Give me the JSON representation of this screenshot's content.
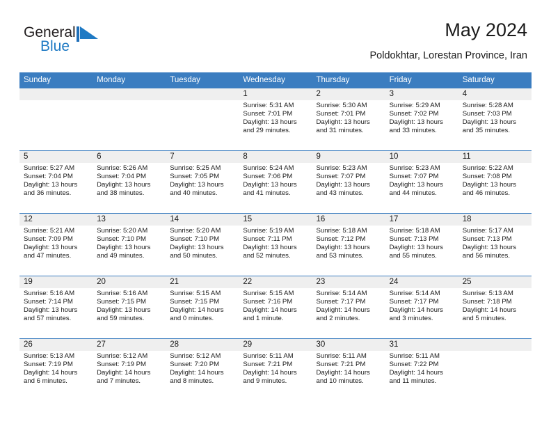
{
  "brand": {
    "name_part1": "General",
    "name_part2": "Blue",
    "flag_color": "#1f7ac4"
  },
  "header": {
    "title": "May 2024",
    "location": "Poldokhtar, Lorestan Province, Iran"
  },
  "theme": {
    "header_blue": "#3b7dc0",
    "daynum_band": "#efefef",
    "rule_blue": "#3b7dc0",
    "text": "#1a1a1a"
  },
  "weekdays": [
    "Sunday",
    "Monday",
    "Tuesday",
    "Wednesday",
    "Thursday",
    "Friday",
    "Saturday"
  ],
  "weeks": [
    [
      {
        "day": "",
        "sunrise": "",
        "sunset": "",
        "daylight_line1": "",
        "daylight_line2": ""
      },
      {
        "day": "",
        "sunrise": "",
        "sunset": "",
        "daylight_line1": "",
        "daylight_line2": ""
      },
      {
        "day": "",
        "sunrise": "",
        "sunset": "",
        "daylight_line1": "",
        "daylight_line2": ""
      },
      {
        "day": "1",
        "sunrise": "Sunrise: 5:31 AM",
        "sunset": "Sunset: 7:01 PM",
        "daylight_line1": "Daylight: 13 hours",
        "daylight_line2": "and 29 minutes."
      },
      {
        "day": "2",
        "sunrise": "Sunrise: 5:30 AM",
        "sunset": "Sunset: 7:01 PM",
        "daylight_line1": "Daylight: 13 hours",
        "daylight_line2": "and 31 minutes."
      },
      {
        "day": "3",
        "sunrise": "Sunrise: 5:29 AM",
        "sunset": "Sunset: 7:02 PM",
        "daylight_line1": "Daylight: 13 hours",
        "daylight_line2": "and 33 minutes."
      },
      {
        "day": "4",
        "sunrise": "Sunrise: 5:28 AM",
        "sunset": "Sunset: 7:03 PM",
        "daylight_line1": "Daylight: 13 hours",
        "daylight_line2": "and 35 minutes."
      }
    ],
    [
      {
        "day": "5",
        "sunrise": "Sunrise: 5:27 AM",
        "sunset": "Sunset: 7:04 PM",
        "daylight_line1": "Daylight: 13 hours",
        "daylight_line2": "and 36 minutes."
      },
      {
        "day": "6",
        "sunrise": "Sunrise: 5:26 AM",
        "sunset": "Sunset: 7:04 PM",
        "daylight_line1": "Daylight: 13 hours",
        "daylight_line2": "and 38 minutes."
      },
      {
        "day": "7",
        "sunrise": "Sunrise: 5:25 AM",
        "sunset": "Sunset: 7:05 PM",
        "daylight_line1": "Daylight: 13 hours",
        "daylight_line2": "and 40 minutes."
      },
      {
        "day": "8",
        "sunrise": "Sunrise: 5:24 AM",
        "sunset": "Sunset: 7:06 PM",
        "daylight_line1": "Daylight: 13 hours",
        "daylight_line2": "and 41 minutes."
      },
      {
        "day": "9",
        "sunrise": "Sunrise: 5:23 AM",
        "sunset": "Sunset: 7:07 PM",
        "daylight_line1": "Daylight: 13 hours",
        "daylight_line2": "and 43 minutes."
      },
      {
        "day": "10",
        "sunrise": "Sunrise: 5:23 AM",
        "sunset": "Sunset: 7:07 PM",
        "daylight_line1": "Daylight: 13 hours",
        "daylight_line2": "and 44 minutes."
      },
      {
        "day": "11",
        "sunrise": "Sunrise: 5:22 AM",
        "sunset": "Sunset: 7:08 PM",
        "daylight_line1": "Daylight: 13 hours",
        "daylight_line2": "and 46 minutes."
      }
    ],
    [
      {
        "day": "12",
        "sunrise": "Sunrise: 5:21 AM",
        "sunset": "Sunset: 7:09 PM",
        "daylight_line1": "Daylight: 13 hours",
        "daylight_line2": "and 47 minutes."
      },
      {
        "day": "13",
        "sunrise": "Sunrise: 5:20 AM",
        "sunset": "Sunset: 7:10 PM",
        "daylight_line1": "Daylight: 13 hours",
        "daylight_line2": "and 49 minutes."
      },
      {
        "day": "14",
        "sunrise": "Sunrise: 5:20 AM",
        "sunset": "Sunset: 7:10 PM",
        "daylight_line1": "Daylight: 13 hours",
        "daylight_line2": "and 50 minutes."
      },
      {
        "day": "15",
        "sunrise": "Sunrise: 5:19 AM",
        "sunset": "Sunset: 7:11 PM",
        "daylight_line1": "Daylight: 13 hours",
        "daylight_line2": "and 52 minutes."
      },
      {
        "day": "16",
        "sunrise": "Sunrise: 5:18 AM",
        "sunset": "Sunset: 7:12 PM",
        "daylight_line1": "Daylight: 13 hours",
        "daylight_line2": "and 53 minutes."
      },
      {
        "day": "17",
        "sunrise": "Sunrise: 5:18 AM",
        "sunset": "Sunset: 7:13 PM",
        "daylight_line1": "Daylight: 13 hours",
        "daylight_line2": "and 55 minutes."
      },
      {
        "day": "18",
        "sunrise": "Sunrise: 5:17 AM",
        "sunset": "Sunset: 7:13 PM",
        "daylight_line1": "Daylight: 13 hours",
        "daylight_line2": "and 56 minutes."
      }
    ],
    [
      {
        "day": "19",
        "sunrise": "Sunrise: 5:16 AM",
        "sunset": "Sunset: 7:14 PM",
        "daylight_line1": "Daylight: 13 hours",
        "daylight_line2": "and 57 minutes."
      },
      {
        "day": "20",
        "sunrise": "Sunrise: 5:16 AM",
        "sunset": "Sunset: 7:15 PM",
        "daylight_line1": "Daylight: 13 hours",
        "daylight_line2": "and 59 minutes."
      },
      {
        "day": "21",
        "sunrise": "Sunrise: 5:15 AM",
        "sunset": "Sunset: 7:15 PM",
        "daylight_line1": "Daylight: 14 hours",
        "daylight_line2": "and 0 minutes."
      },
      {
        "day": "22",
        "sunrise": "Sunrise: 5:15 AM",
        "sunset": "Sunset: 7:16 PM",
        "daylight_line1": "Daylight: 14 hours",
        "daylight_line2": "and 1 minute."
      },
      {
        "day": "23",
        "sunrise": "Sunrise: 5:14 AM",
        "sunset": "Sunset: 7:17 PM",
        "daylight_line1": "Daylight: 14 hours",
        "daylight_line2": "and 2 minutes."
      },
      {
        "day": "24",
        "sunrise": "Sunrise: 5:14 AM",
        "sunset": "Sunset: 7:17 PM",
        "daylight_line1": "Daylight: 14 hours",
        "daylight_line2": "and 3 minutes."
      },
      {
        "day": "25",
        "sunrise": "Sunrise: 5:13 AM",
        "sunset": "Sunset: 7:18 PM",
        "daylight_line1": "Daylight: 14 hours",
        "daylight_line2": "and 5 minutes."
      }
    ],
    [
      {
        "day": "26",
        "sunrise": "Sunrise: 5:13 AM",
        "sunset": "Sunset: 7:19 PM",
        "daylight_line1": "Daylight: 14 hours",
        "daylight_line2": "and 6 minutes."
      },
      {
        "day": "27",
        "sunrise": "Sunrise: 5:12 AM",
        "sunset": "Sunset: 7:19 PM",
        "daylight_line1": "Daylight: 14 hours",
        "daylight_line2": "and 7 minutes."
      },
      {
        "day": "28",
        "sunrise": "Sunrise: 5:12 AM",
        "sunset": "Sunset: 7:20 PM",
        "daylight_line1": "Daylight: 14 hours",
        "daylight_line2": "and 8 minutes."
      },
      {
        "day": "29",
        "sunrise": "Sunrise: 5:11 AM",
        "sunset": "Sunset: 7:21 PM",
        "daylight_line1": "Daylight: 14 hours",
        "daylight_line2": "and 9 minutes."
      },
      {
        "day": "30",
        "sunrise": "Sunrise: 5:11 AM",
        "sunset": "Sunset: 7:21 PM",
        "daylight_line1": "Daylight: 14 hours",
        "daylight_line2": "and 10 minutes."
      },
      {
        "day": "31",
        "sunrise": "Sunrise: 5:11 AM",
        "sunset": "Sunset: 7:22 PM",
        "daylight_line1": "Daylight: 14 hours",
        "daylight_line2": "and 11 minutes."
      },
      {
        "day": "",
        "sunrise": "",
        "sunset": "",
        "daylight_line1": "",
        "daylight_line2": ""
      }
    ]
  ]
}
